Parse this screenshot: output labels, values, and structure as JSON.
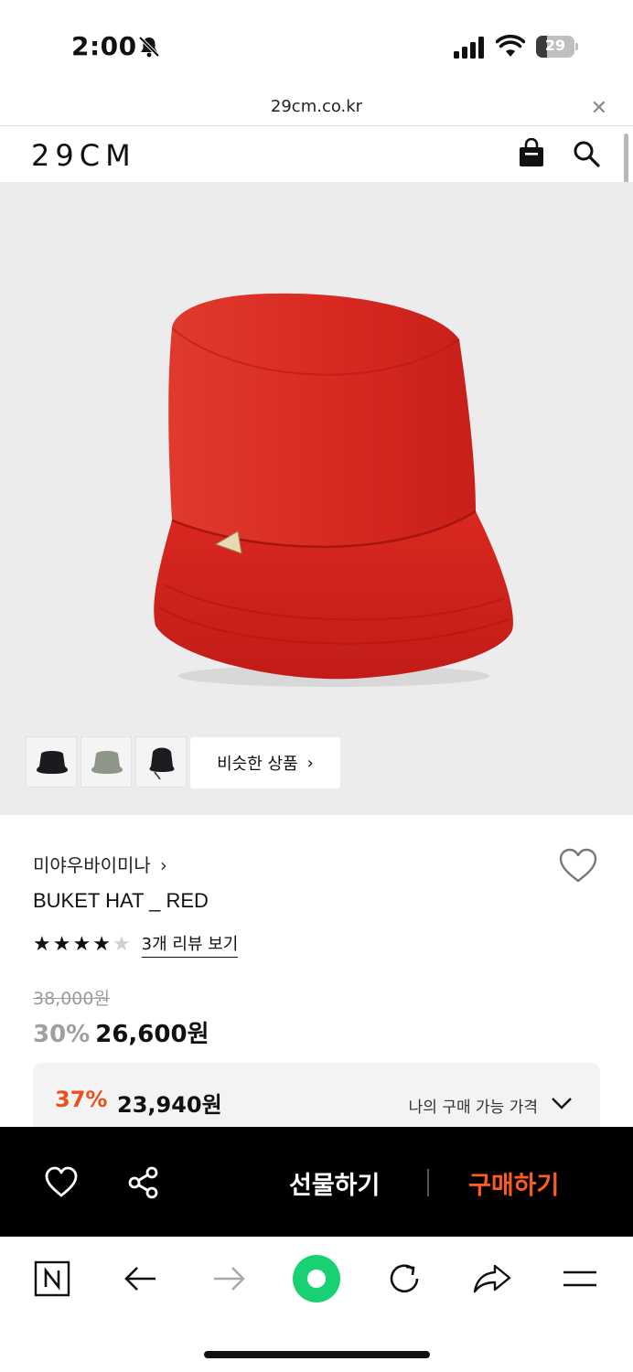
{
  "status_bar": {
    "time": "2:00",
    "battery": "29",
    "battery_level": 0.29
  },
  "url_bar": {
    "url": "29cm.co.kr",
    "close_icon": "close-icon"
  },
  "header": {
    "logo": "29CM",
    "icons": [
      "shopping-bag-icon",
      "search-icon"
    ]
  },
  "gallery": {
    "main_image": "red bucket hat",
    "thumbnails": [
      "black bucket hat",
      "grey bucket hat",
      "black hat with strap"
    ],
    "similar_label": "비슷한 상품",
    "similar_chevron": "›"
  },
  "product": {
    "brand": "미야우바이미나",
    "brand_chevron": "›",
    "name": "BUKET HAT _ RED",
    "rating": 4,
    "rating_max": 5,
    "review_link": "3개 리뷰 보기",
    "original_price": "38,000원",
    "discount_pct": "30%",
    "sale_price": "26,600원"
  },
  "my_price": {
    "discount_pct": "37%",
    "price": "23,940원",
    "label": "나의 구매 가능 가격"
  },
  "buy_bar": {
    "gift_label": "선물하기",
    "buy_label": "구매하기"
  },
  "colors": {
    "accent_orange": "#ff5a1f",
    "discount_orange": "#e9501c",
    "hat_red": "#d9231f",
    "green_button": "#19d173"
  },
  "browser_nav": {
    "icons": [
      "naver-n-icon",
      "back-arrow-icon",
      "forward-arrow-icon",
      "green-home-icon",
      "reload-icon",
      "share-icon",
      "menu-icon"
    ]
  }
}
